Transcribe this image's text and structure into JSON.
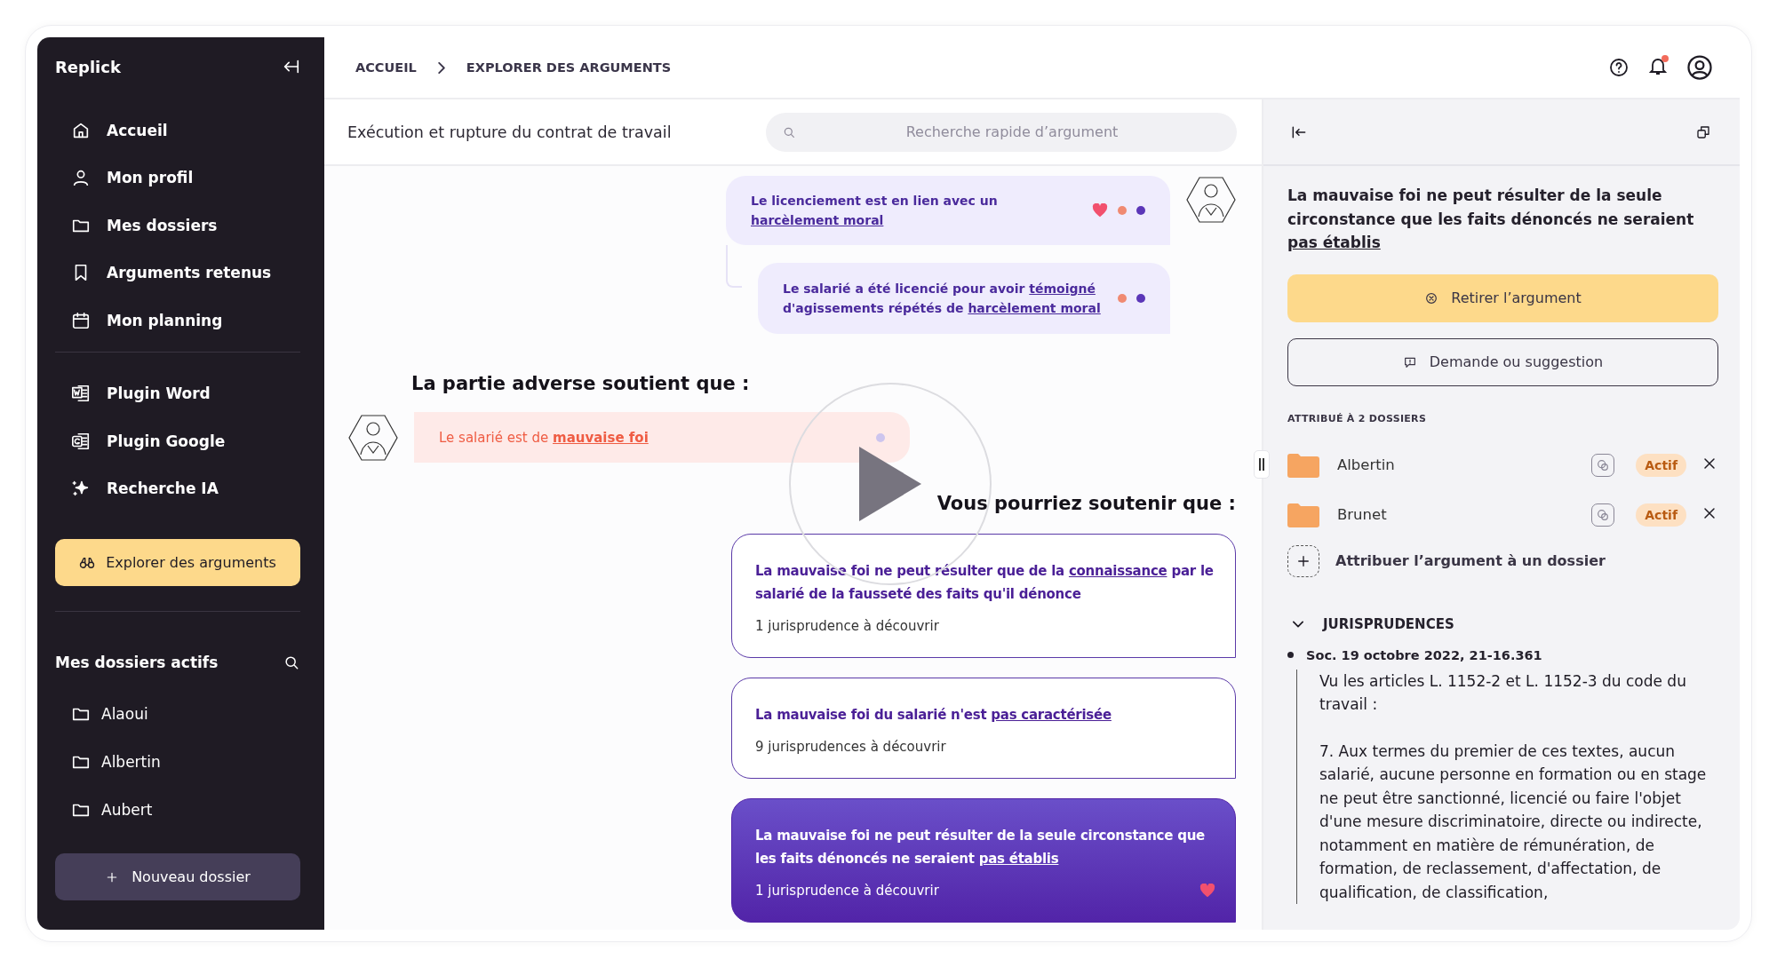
{
  "sidebar": {
    "brand": "Replick",
    "nav": [
      {
        "label": "Accueil",
        "kind": "home",
        "selected": false
      },
      {
        "label": "Mon profil",
        "kind": "user",
        "selected": false
      },
      {
        "label": "Mes dossiers",
        "kind": "folder",
        "selected": false
      },
      {
        "label": "Arguments retenus",
        "kind": "bookmark",
        "selected": false
      },
      {
        "label": "Mon planning",
        "kind": "calendar",
        "selected": false
      }
    ],
    "tools": [
      {
        "label": "Plugin Word",
        "kind": "word"
      },
      {
        "label": "Plugin Google",
        "kind": "google"
      },
      {
        "label": "Recherche IA",
        "kind": "sparkle"
      }
    ],
    "cta": "Explorer des arguments",
    "active_title": "Mes dossiers actifs",
    "active_folders": [
      "Alaoui",
      "Albertin",
      "Aubert"
    ],
    "new_button": "Nouveau dossier"
  },
  "breadcrumb": [
    "ACCUEIL",
    "EXPLORER DES ARGUMENTS"
  ],
  "has_notifications": true,
  "topic": "Exécution et rupture du contrat de travail",
  "search": {
    "placeholder": "Recherche rapide d’argument"
  },
  "claims": [
    {
      "text": "Le licenciement est en lien avec un **harcèlement moral**",
      "markers": [
        {
          "kind": "heart",
          "color": "#f2506e"
        },
        {
          "kind": "dot",
          "color": "#f08a72"
        },
        {
          "kind": "dot",
          "color": "#5b36b8"
        }
      ]
    },
    {
      "text": "Le salarié a été licencié pour avoir **témoigné** d'agissements répétés de **harcèlement moral**",
      "markers": [
        {
          "kind": "dot",
          "color": "#f08a72"
        },
        {
          "kind": "dot",
          "color": "#5b36b8"
        }
      ]
    }
  ],
  "opponent_heading": "La partie adverse soutient que :",
  "opponent_claim": {
    "text": "Le salarié est de **mauvaise foi**",
    "markers": [
      {
        "kind": "dot",
        "color": "#cdc5ee"
      }
    ]
  },
  "answer_heading": "Vous pourriez soutenir que :",
  "answers": [
    {
      "text": "La mauvaise foi ne peut résulter que de la **connaissance** par le salarié de la fausseté des faits qu'il dénonce",
      "count": "1 jurisprudence à découvrir",
      "selected": false,
      "liked": false
    },
    {
      "text": "La mauvaise foi du salarié n'est **pas caractérisée**",
      "count": "9 jurisprudences à découvrir",
      "selected": false,
      "liked": false
    },
    {
      "text": "La mauvaise foi ne peut résulter de la seule circonstance que les faits dénoncés ne seraient **pas établis**",
      "count": "1 jurisprudence à découvrir",
      "selected": true,
      "liked": true
    }
  ],
  "player": {
    "playing": false
  },
  "detail": {
    "title": "La mauvaise foi ne peut résulter de la seule circonstance que les faits dénoncés ne seraient **pas établis**",
    "remove_button": "Retirer l’argument",
    "request_button": "Demande ou suggestion",
    "assigned_label": "ATTRIBUÉ À 2 DOSSIERS",
    "folders": [
      {
        "name": "Albertin",
        "status": "Actif"
      },
      {
        "name": "Brunet",
        "status": "Actif"
      }
    ],
    "assign_link": "Attribuer l’argument à un dossier",
    "section": {
      "title": "JURISPRUDENCES",
      "expanded": true
    },
    "cases": [
      {
        "ref": "Soc. 19 octobre 2022, 21-16.361",
        "paragraphs": [
          "Vu les articles L. 1152-2 et L. 1152-3 du code du travail :",
          "7. Aux termes du premier de ces textes, aucun salarié, aucune personne en formation ou en stage ne peut être sanctionné, licencié ou faire l'objet d'une mesure discriminatoire, directe ou indirecte, notamment en matière de rémunération, de formation, de reclassement, d'affectation, de qualification, de classification,"
        ]
      }
    ]
  }
}
